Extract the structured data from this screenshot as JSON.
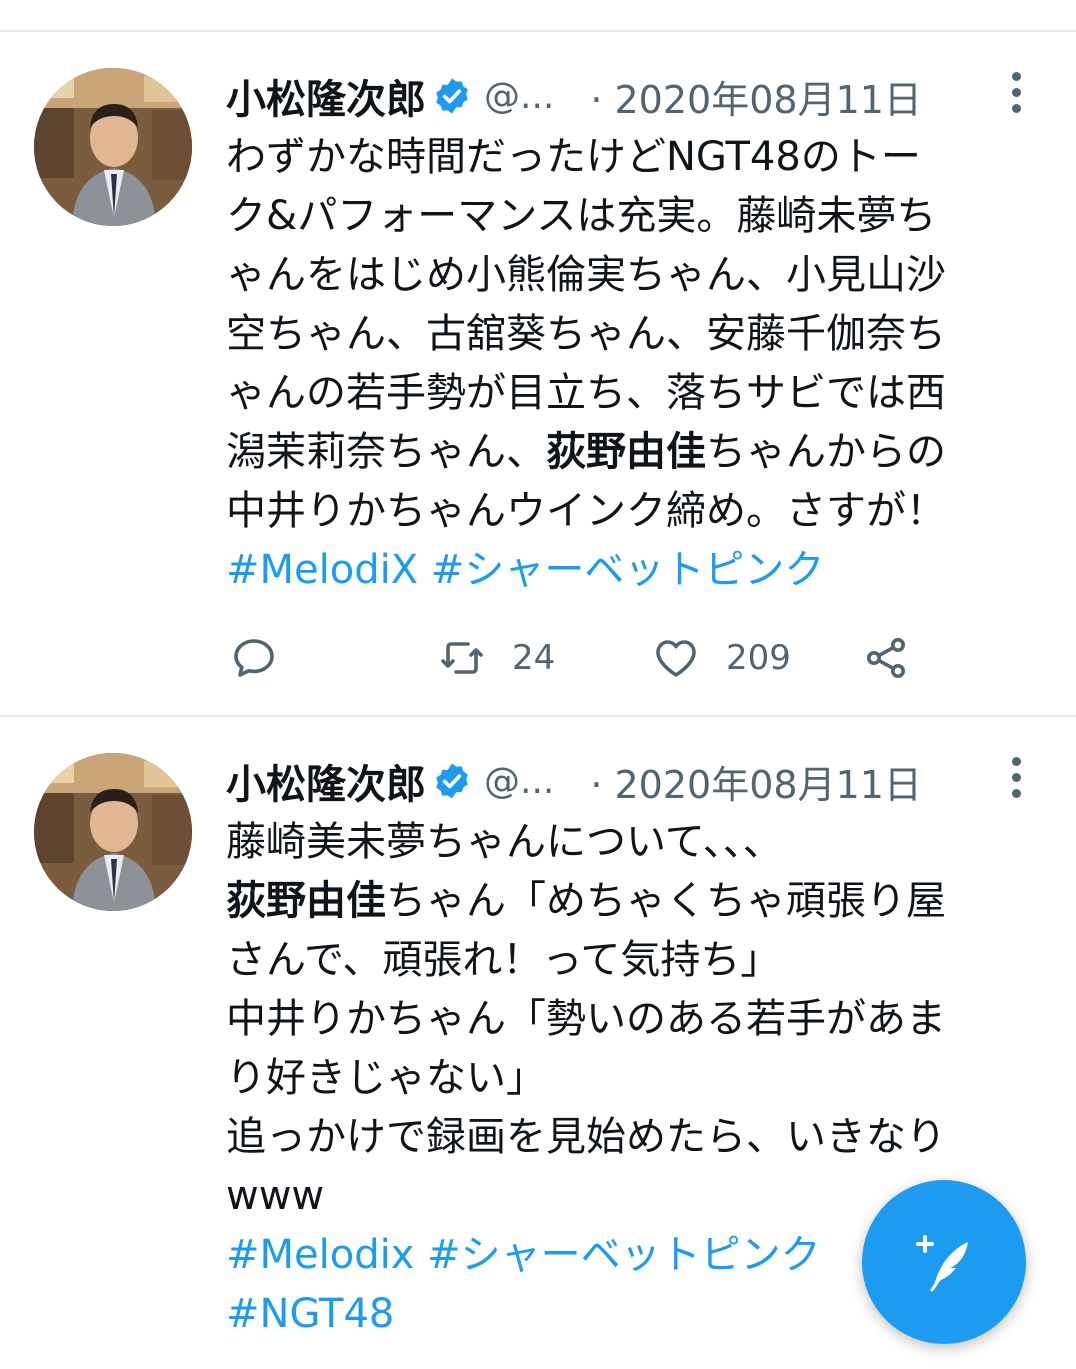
{
  "colors": {
    "accent": "#1d9bf0",
    "text": "#0f1419",
    "muted": "#536471",
    "divider": "#e6ecf0"
  },
  "tweets": [
    {
      "author": "小松隆次郎",
      "handle": "@...",
      "date": "· 2020年08月11日",
      "lines": [
        [
          {
            "text": "わずかな時間だったけどNGT48のトー"
          }
        ],
        [
          {
            "text": "ク&パフォーマンスは充実。藤崎未夢ち"
          }
        ],
        [
          {
            "text": "ゃんをはじめ小熊倫実ちゃん、小見山沙"
          }
        ],
        [
          {
            "text": "空ちゃん、古舘葵ちゃん、安藤千伽奈ち"
          }
        ],
        [
          {
            "text": "ゃんの若手勢が目立ち、落ちサビでは西"
          }
        ],
        [
          {
            "text": "潟茉莉奈ちゃん、"
          },
          {
            "text": "荻野由佳",
            "bold": true
          },
          {
            "text": "ちゃんからの"
          }
        ],
        [
          {
            "text": "中井りかちゃんウインク締め。さすが！"
          }
        ]
      ],
      "hashtags": [
        "#MelodiX",
        "#シャーベットピンク"
      ],
      "retweets": "24",
      "likes": "209",
      "icons": [
        "reply-icon",
        "retweet-icon",
        "like-icon",
        "share-icon"
      ]
    },
    {
      "author": "小松隆次郎",
      "handle": "@...",
      "date": "· 2020年08月11日",
      "lines": [
        [
          {
            "text": "藤崎美未夢ちゃんについて、、、"
          }
        ],
        [
          {
            "text": "荻野由佳",
            "bold": true
          },
          {
            "text": "ちゃん「めちゃくちゃ頑張り屋"
          }
        ],
        [
          {
            "text": "さんで、頑張れ！って気持ち」"
          }
        ],
        [
          {
            "text": "中井りかちゃん「勢いのある若手があま"
          }
        ],
        [
          {
            "text": "り好きじゃない」"
          }
        ],
        [
          {
            "text": "追っかけで録画を見始めたら、いきなり"
          }
        ],
        [
          {
            "text": "www"
          }
        ]
      ],
      "hashtags_line1": [
        "#Melodix",
        "#シャーベットピンク"
      ],
      "hashtags_line2": [
        "#NGT48"
      ]
    }
  ],
  "fab": {
    "icon": "compose-tweet-icon"
  }
}
